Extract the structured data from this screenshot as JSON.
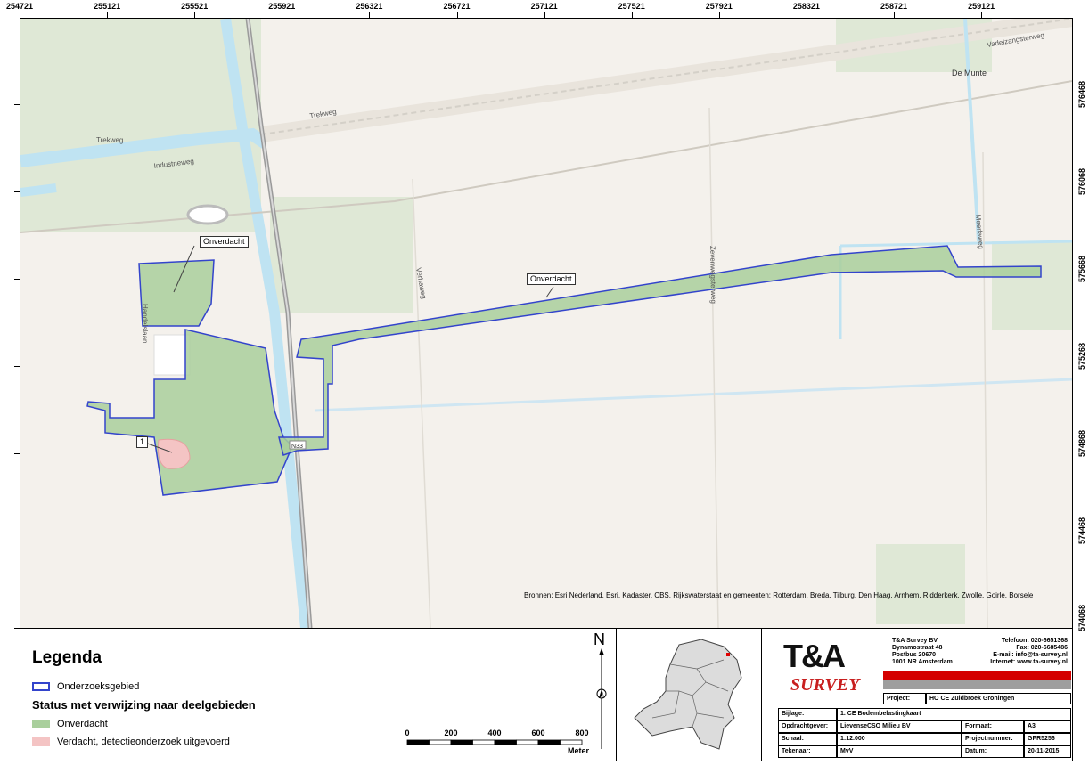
{
  "coordinates": {
    "x_ticks": [
      "254721",
      "255121",
      "255521",
      "255921",
      "256321",
      "256721",
      "257121",
      "257521",
      "257921",
      "258321",
      "258721",
      "259121"
    ],
    "y_ticks": [
      "576468",
      "576068",
      "575668",
      "575268",
      "574868",
      "574468",
      "574068"
    ]
  },
  "map": {
    "road_labels": {
      "vrtweg": "Trekweg",
      "trekweg2": "Trekweg",
      "industrieweg": "Industrieweg",
      "vadelzangsterweg": "Vadelzangsterweg",
      "verhaweg": "Verhaweg",
      "zevenwegsterweg": "Zevenwegsterweg",
      "meerlaweg": "Meerlaweg",
      "vaartlaan": "Handelslaan",
      "n33": "N33"
    },
    "place_labels": {
      "demunte": "De Munte"
    },
    "callouts": {
      "onverdacht1": "Onverdacht",
      "onverdacht2": "Onverdacht",
      "area1": "1"
    },
    "sources": "Bronnen: Esri Nederland, Esri, Kadaster, CBS, Rijkswaterstaat en gemeenten: Rotterdam, Breda, Tilburg, Den Haag, Arnhem, Ridderkerk, Zwolle, Goirle, Borsele",
    "colors": {
      "background": "#f4f1ec",
      "water": "#bfe3f2",
      "green_field": "#dfe8d6",
      "onverdacht": "#a9cf9c",
      "verdacht": "#f4c4c4",
      "boundary": "#3344cc"
    }
  },
  "legend": {
    "title": "Legenda",
    "boundary_label": "Onderzoeksgebied",
    "subtitle": "Status met verwijzing naar deelgebieden",
    "onverdacht_label": "Onverdacht",
    "verdacht_label": "Verdacht, detectieonderzoek uitgevoerd"
  },
  "scale": {
    "ticks": [
      "0",
      "200",
      "400",
      "600",
      "800"
    ],
    "unit": "Meter"
  },
  "north": {
    "label": "N"
  },
  "titleblock": {
    "company_name": "T&A Survey BV",
    "company_address": "Dynamostraat 48\nPostbus 20670\n1001 NR Amsterdam",
    "company_contact_labels": "Telefoon: 020-6651368\nFax: 020-6685486\nE-mail: info@ta-survey.nl\nInternet: www.ta-survey.nl",
    "logo_text": "T&A",
    "logo_sub": "SURVEY",
    "project_label": "Project:",
    "project_value": "HO CE Zuidbroek Groningen",
    "bijlage_label": "Bijlage:",
    "bijlage_value": "1. CE Bodembelastingkaart",
    "opdrachtgever_label": "Opdrachtgever:",
    "opdrachtgever_value": "LievenseCSO Milieu BV",
    "formaat_label": "Formaat:",
    "formaat_value": "A3",
    "schaal_label": "Schaal:",
    "schaal_value": "1:12.000",
    "projectnummer_label": "Projectnummer:",
    "projectnummer_value": "GPR5256",
    "tekenaar_label": "Tekenaar:",
    "tekenaar_value": "MvV",
    "datum_label": "Datum:",
    "datum_value": "20-11-2015"
  }
}
